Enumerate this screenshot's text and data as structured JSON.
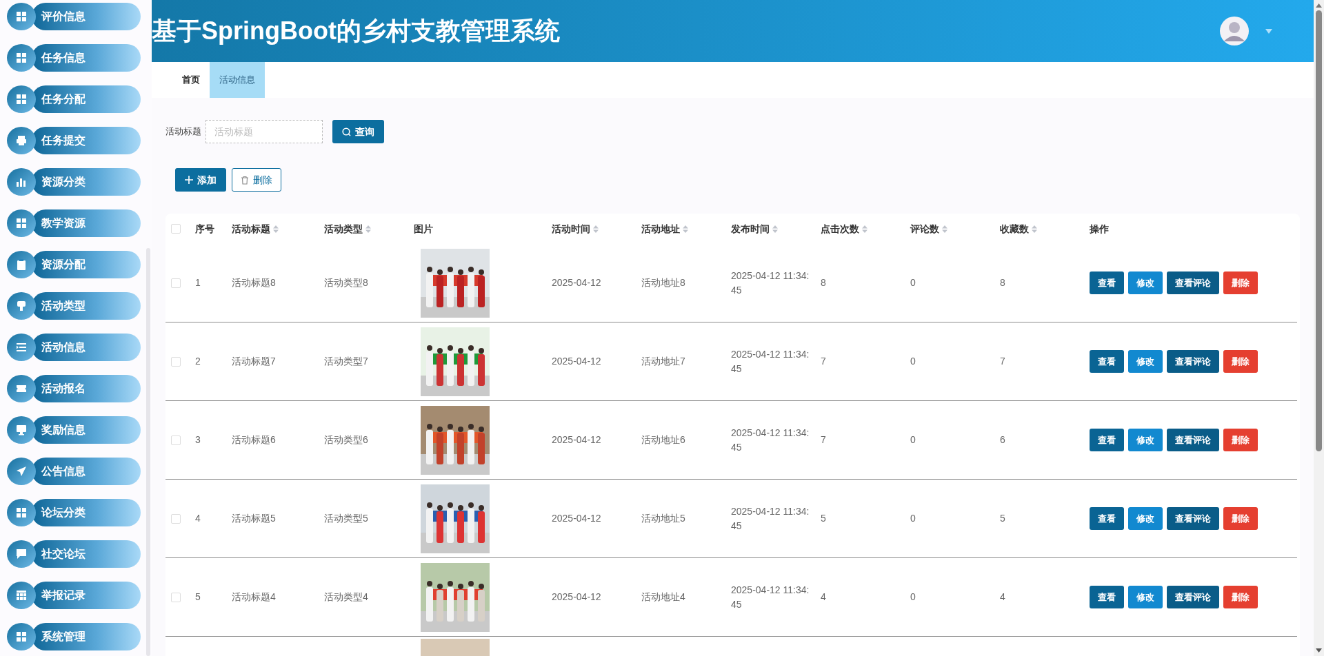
{
  "sidebar": {
    "items": [
      {
        "label": "评价信息",
        "kind": "grid"
      },
      {
        "label": "任务信息",
        "kind": "grid"
      },
      {
        "label": "任务分配",
        "kind": "grid"
      },
      {
        "label": "任务提交",
        "kind": "printer"
      },
      {
        "label": "资源分类",
        "kind": "bars"
      },
      {
        "label": "教学资源",
        "kind": "grid"
      },
      {
        "label": "资源分配",
        "kind": "clipboard"
      },
      {
        "label": "活动类型",
        "kind": "brush"
      },
      {
        "label": "活动信息",
        "kind": "list"
      },
      {
        "label": "活动报名",
        "kind": "ticket"
      },
      {
        "label": "奖励信息",
        "kind": "monitor"
      },
      {
        "label": "公告信息",
        "kind": "plane"
      },
      {
        "label": "论坛分类",
        "kind": "grid"
      },
      {
        "label": "社交论坛",
        "kind": "chat"
      },
      {
        "label": "举报记录",
        "kind": "table"
      },
      {
        "label": "系统管理",
        "kind": "grid"
      }
    ]
  },
  "header": {
    "title": "基于SpringBoot的乡村支教管理系统"
  },
  "tabs": [
    {
      "label": "首页",
      "selected": false
    },
    {
      "label": "活动信息",
      "selected": true
    }
  ],
  "search": {
    "label": "活动标题",
    "placeholder": "活动标题",
    "button": "查询"
  },
  "toolbar": {
    "add": "添加",
    "delete": "删除"
  },
  "table": {
    "select_all_checked": false,
    "columns": [
      {
        "label": "序号",
        "sortable": false
      },
      {
        "label": "活动标题",
        "sortable": true
      },
      {
        "label": "活动类型",
        "sortable": true
      },
      {
        "label": "图片",
        "sortable": false
      },
      {
        "label": "活动时间",
        "sortable": true
      },
      {
        "label": "活动地址",
        "sortable": true
      },
      {
        "label": "发布时间",
        "sortable": true
      },
      {
        "label": "点击次数",
        "sortable": true
      },
      {
        "label": "评论数",
        "sortable": true
      },
      {
        "label": "收藏数",
        "sortable": true
      },
      {
        "label": "操作",
        "sortable": false
      }
    ],
    "rows": [
      {
        "kind": "data",
        "checked": false,
        "no": "1",
        "title": "活动标题8",
        "type": "活动类型8",
        "time": "2025-04-12",
        "address": "活动地址8",
        "published": "2025-04-12 11:34:45",
        "clicks": "8",
        "comments": "0",
        "favorites": "8",
        "actions": [
          {
            "label": "查看",
            "kind": "view"
          },
          {
            "label": "修改",
            "kind": "edit"
          },
          {
            "label": "查看评论",
            "kind": "comments"
          },
          {
            "label": "删除",
            "kind": "delete"
          }
        ]
      },
      {
        "kind": "data",
        "checked": false,
        "no": "2",
        "title": "活动标题7",
        "type": "活动类型7",
        "time": "2025-04-12",
        "address": "活动地址7",
        "published": "2025-04-12 11:34:45",
        "clicks": "7",
        "comments": "0",
        "favorites": "7",
        "actions": [
          {
            "label": "查看",
            "kind": "view"
          },
          {
            "label": "修改",
            "kind": "edit"
          },
          {
            "label": "查看评论",
            "kind": "comments"
          },
          {
            "label": "删除",
            "kind": "delete"
          }
        ]
      },
      {
        "kind": "data",
        "checked": false,
        "no": "3",
        "title": "活动标题6",
        "type": "活动类型6",
        "time": "2025-04-12",
        "address": "活动地址6",
        "published": "2025-04-12 11:34:45",
        "clicks": "7",
        "comments": "0",
        "favorites": "6",
        "actions": [
          {
            "label": "查看",
            "kind": "view"
          },
          {
            "label": "修改",
            "kind": "edit"
          },
          {
            "label": "查看评论",
            "kind": "comments"
          },
          {
            "label": "删除",
            "kind": "delete"
          }
        ]
      },
      {
        "kind": "data",
        "checked": false,
        "no": "4",
        "title": "活动标题5",
        "type": "活动类型5",
        "time": "2025-04-12",
        "address": "活动地址5",
        "published": "2025-04-12 11:34:45",
        "clicks": "5",
        "comments": "0",
        "favorites": "5",
        "actions": [
          {
            "label": "查看",
            "kind": "view"
          },
          {
            "label": "修改",
            "kind": "edit"
          },
          {
            "label": "查看评论",
            "kind": "comments"
          },
          {
            "label": "删除",
            "kind": "delete"
          }
        ]
      },
      {
        "kind": "data",
        "checked": false,
        "no": "5",
        "title": "活动标题4",
        "type": "活动类型4",
        "time": "2025-04-12",
        "address": "活动地址4",
        "published": "2025-04-12 11:34:45",
        "clicks": "4",
        "comments": "0",
        "favorites": "4",
        "actions": [
          {
            "label": "查看",
            "kind": "view"
          },
          {
            "label": "修改",
            "kind": "edit"
          },
          {
            "label": "查看评论",
            "kind": "comments"
          },
          {
            "label": "删除",
            "kind": "delete"
          }
        ]
      },
      {
        "kind": "partial"
      }
    ]
  }
}
